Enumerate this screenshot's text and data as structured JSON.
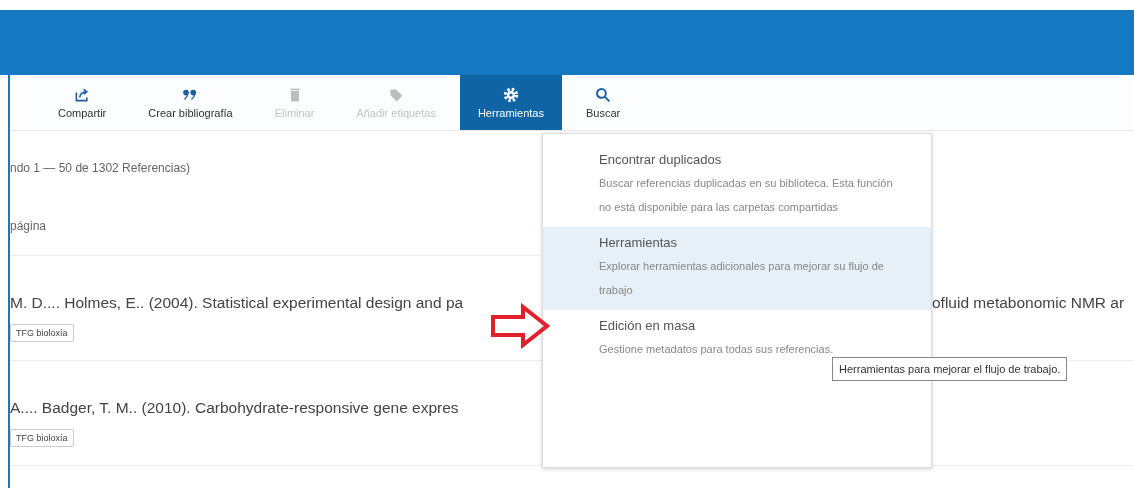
{
  "toolbar": [
    {
      "kind": "share",
      "label": "Compartir",
      "disabled": false,
      "selected": false
    },
    {
      "kind": "quote",
      "label": "Crear bibliografía",
      "disabled": false,
      "selected": false
    },
    {
      "kind": "trash",
      "label": "Eliminar",
      "disabled": true,
      "selected": false
    },
    {
      "kind": "tag",
      "label": "Añadir etiquetas",
      "disabled": true,
      "selected": false
    },
    {
      "kind": "gear",
      "label": "Herramientas",
      "disabled": false,
      "selected": true
    },
    {
      "kind": "search",
      "label": "Buscar",
      "disabled": false,
      "selected": false
    }
  ],
  "summary": "ndo 1 — 50 de 1302 Referencias)",
  "per_page": "página",
  "references": [
    {
      "text": "M. D.... Holmes, E.. (2004). Statistical experimental design and pa",
      "text_after_menu": "ofluid metabonomic NMR ar",
      "tag": "TFG bioloxía"
    },
    {
      "text": "A.... Badger, T. M.. (2010). Carbohydrate-responsive gene expres",
      "tag": "TFG bioloxía"
    }
  ],
  "menu": [
    {
      "title": "Encontrar duplicados",
      "description": "Buscar referencias duplicadas en su biblioteca. Esta función no está disponible para las carpetas compartidas",
      "selected": false
    },
    {
      "title": "Herramientas",
      "description": "Explorar herramientas adicionales para mejorar su flujo de trabajo",
      "selected": true
    },
    {
      "title": "Edición en masa",
      "description": "Gestione metadatos para todas sus referencias.",
      "selected": false
    }
  ],
  "tooltip": "Herramientas para mejorar el flujo de trabajo."
}
